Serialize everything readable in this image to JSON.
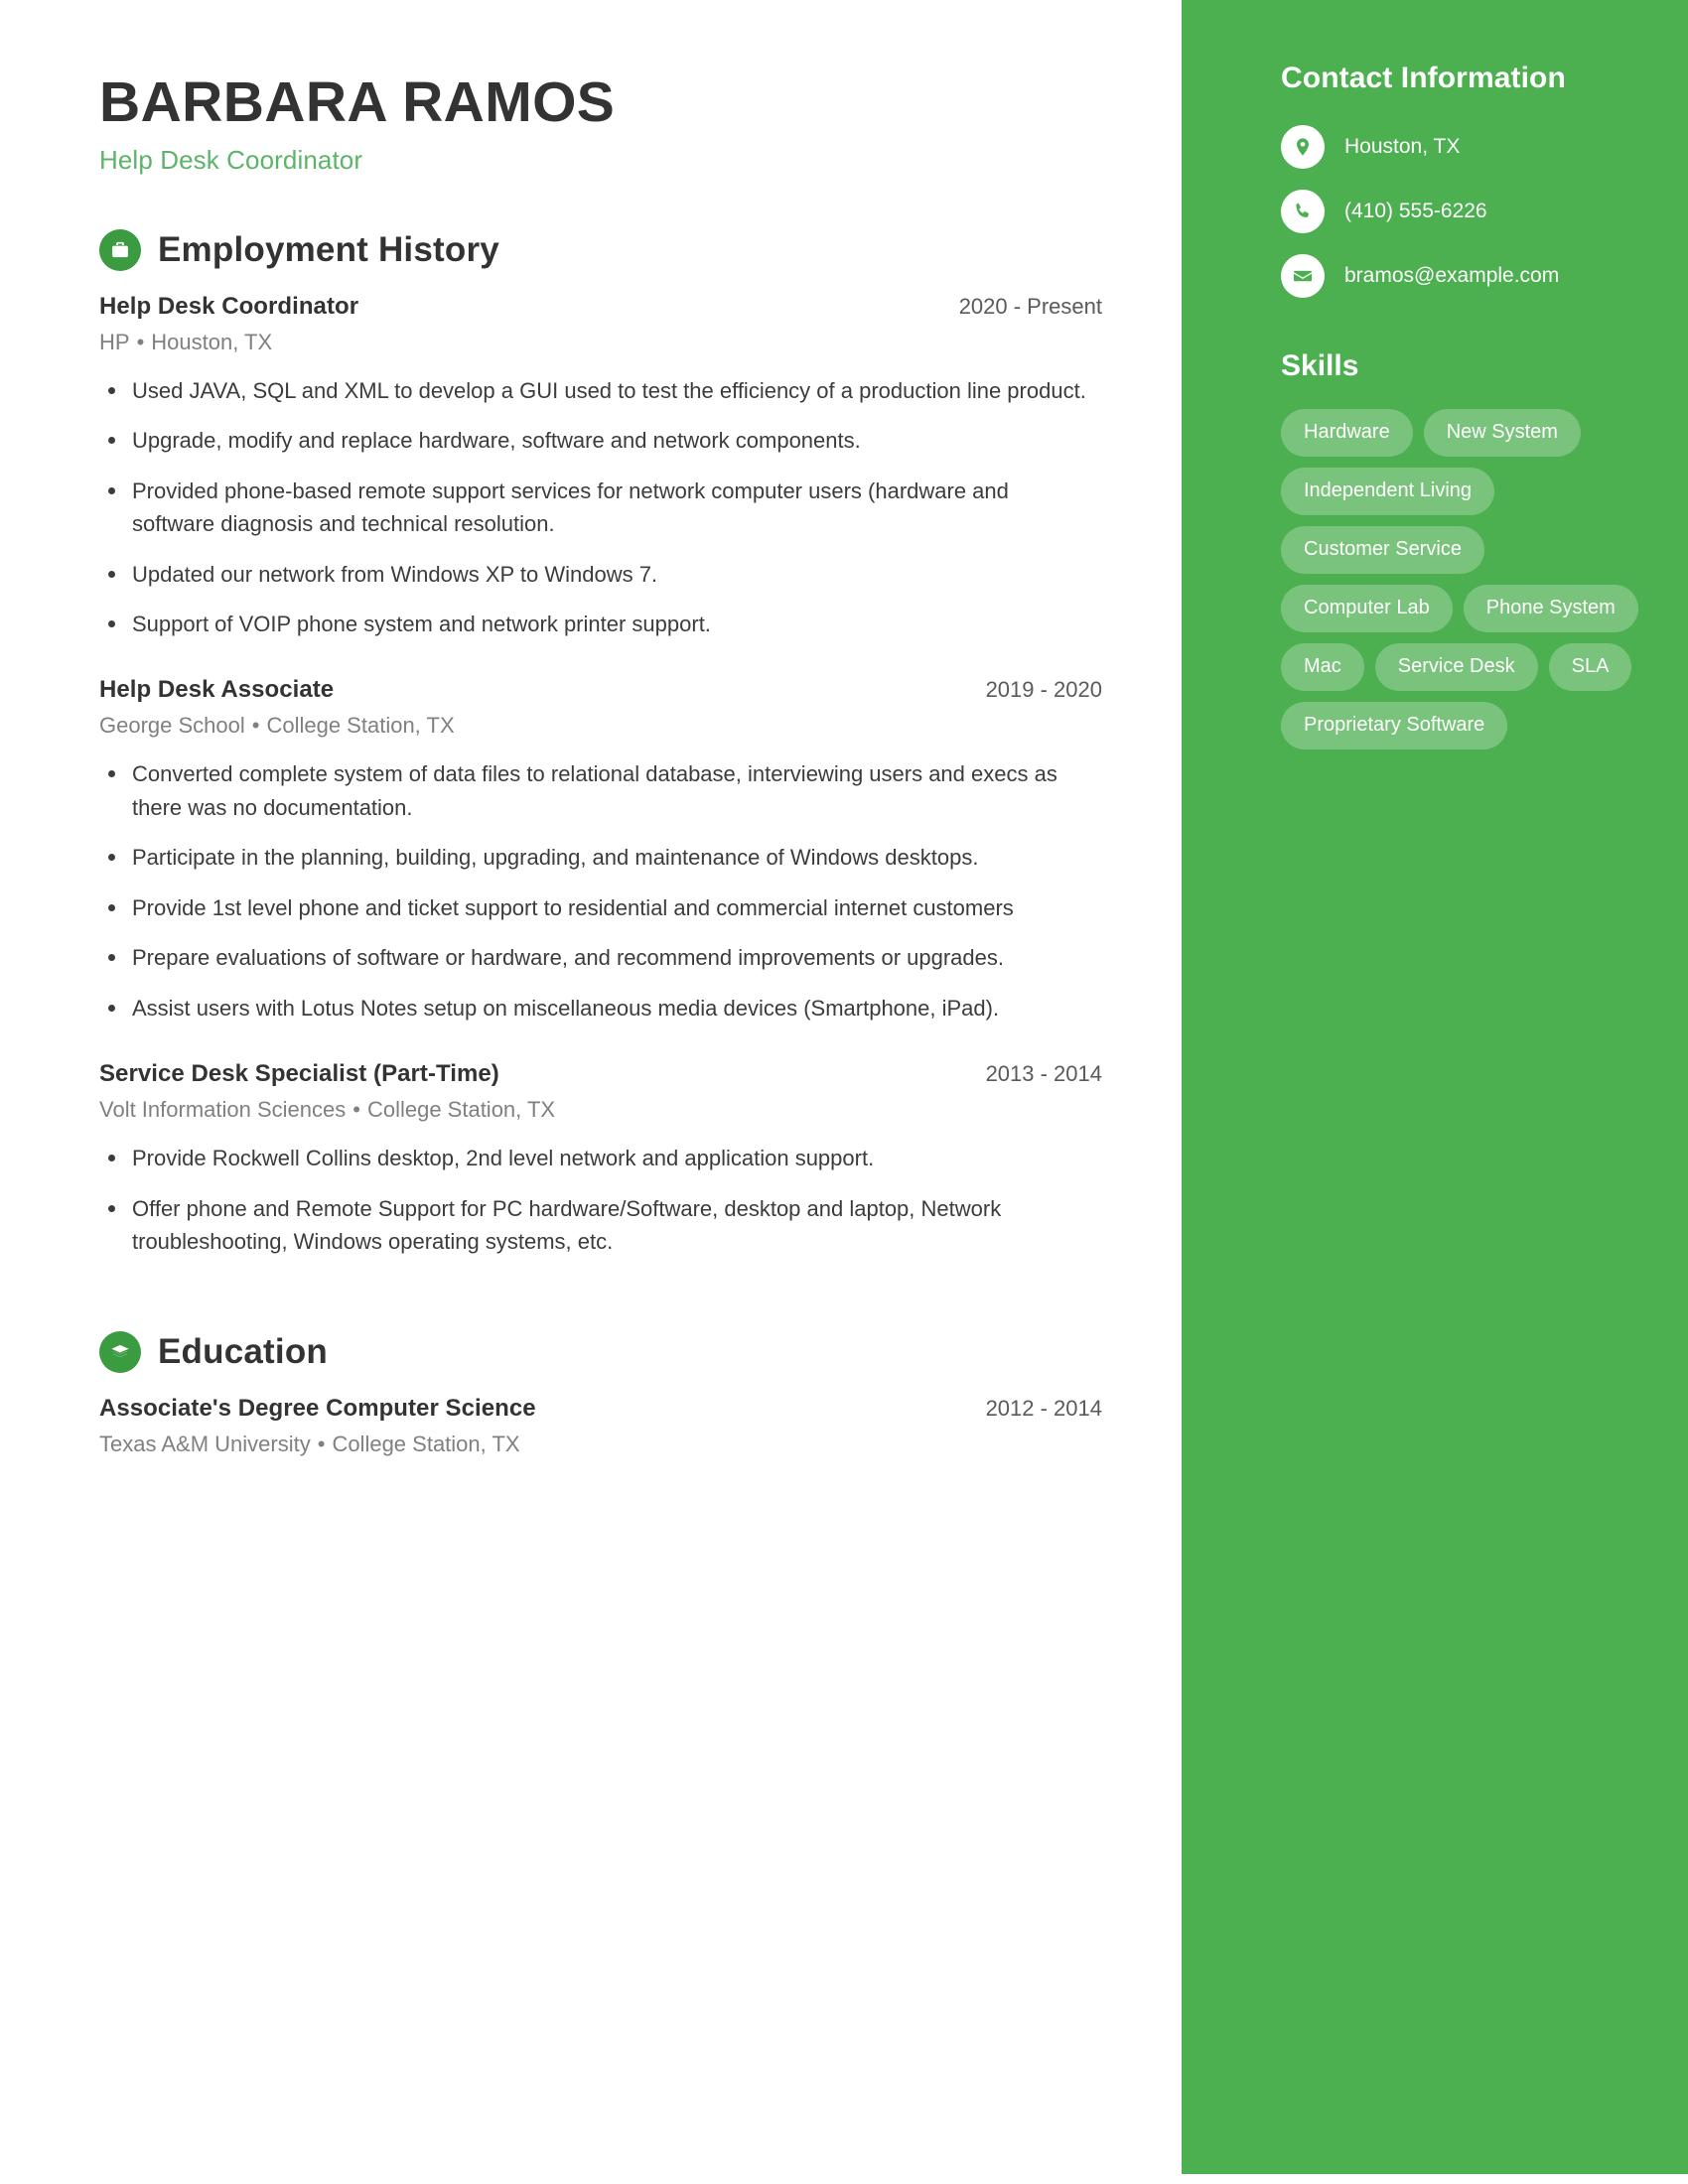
{
  "header": {
    "name": "BARBARA RAMOS",
    "job_title": "Help Desk Coordinator"
  },
  "theme": {
    "sidebar_green": "#4caf50",
    "accent_green": "#5cb469",
    "icon_green": "#3a9b41",
    "text_dark": "#333333",
    "text_muted": "#808080"
  },
  "sidebar": {
    "contact_heading": "Contact Information",
    "contact": [
      {
        "icon": "location-pin-icon",
        "value": "Houston, TX"
      },
      {
        "icon": "phone-icon",
        "value": "(410) 555-6226"
      },
      {
        "icon": "envelope-icon",
        "value": "bramos@example.com"
      }
    ],
    "skills_heading": "Skills",
    "skills": [
      "Hardware",
      "New System",
      "Independent Living",
      "Customer Service",
      "Computer Lab",
      "Phone System",
      "Mac",
      "Service Desk",
      "SLA",
      "Proprietary Software"
    ]
  },
  "sections": {
    "employment": {
      "title": "Employment History",
      "icon": "briefcase-icon",
      "entries": [
        {
          "title": "Help Desk Coordinator",
          "date": "2020 - Present",
          "company": "HP",
          "location": "Houston, TX",
          "bullets": [
            "Used JAVA, SQL and XML to develop a GUI used to test the efficiency of a production line product.",
            "Upgrade, modify and replace hardware, software and network components.",
            "Provided phone-based remote support services for network computer users (hardware and software diagnosis and technical resolution.",
            "Updated our network from Windows XP to Windows 7.",
            "Support of VOIP phone system and network printer support."
          ]
        },
        {
          "title": "Help Desk Associate",
          "date": "2019 - 2020",
          "company": "George School",
          "location": "College Station, TX",
          "bullets": [
            "Converted complete system of data files to relational database, interviewing users and execs as there was no documentation.",
            "Participate in the planning, building, upgrading, and maintenance of Windows desktops.",
            "Provide 1st level phone and ticket support to residential and commercial internet customers",
            "Prepare evaluations of software or hardware, and recommend improvements or upgrades.",
            "Assist users with Lotus Notes setup on miscellaneous media devices (Smartphone, iPad)."
          ]
        },
        {
          "title": "Service Desk Specialist (Part-Time)",
          "date": "2013 - 2014",
          "company": "Volt Information Sciences",
          "location": "College Station, TX",
          "bullets": [
            "Provide Rockwell Collins desktop, 2nd level network and application support.",
            "Offer phone and Remote Support for PC hardware/Software, desktop and laptop, Network troubleshooting, Windows operating systems, etc."
          ]
        }
      ]
    },
    "education": {
      "title": "Education",
      "icon": "graduation-cap-icon",
      "entries": [
        {
          "title": "Associate's Degree Computer Science",
          "date": "2012 - 2014",
          "school": "Texas A&M University",
          "location": "College Station, TX"
        }
      ]
    }
  }
}
